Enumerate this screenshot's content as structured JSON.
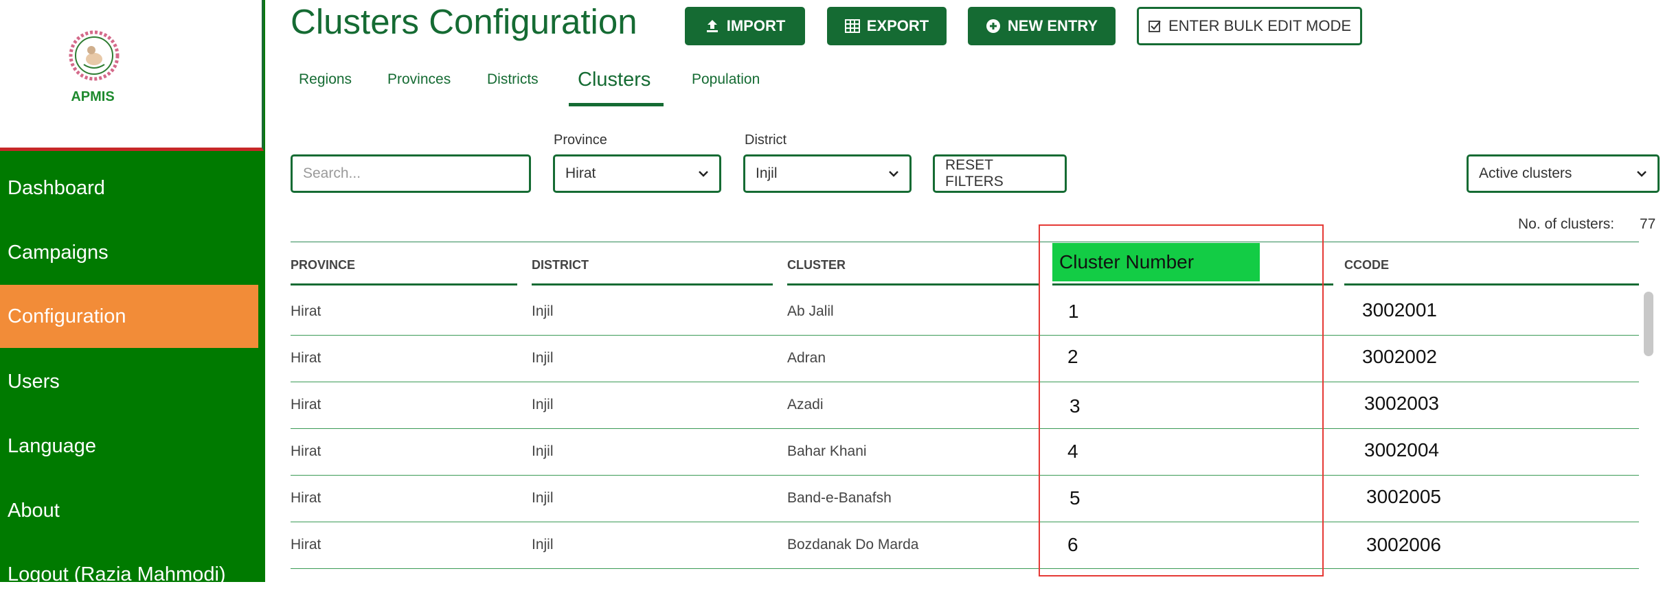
{
  "app": {
    "name": "APMIS"
  },
  "sidebar": {
    "items": [
      {
        "label": "Dashboard",
        "active": false
      },
      {
        "label": "Campaigns",
        "active": false
      },
      {
        "label": "Configuration",
        "active": true
      },
      {
        "label": "Users",
        "active": false
      },
      {
        "label": "Language",
        "active": false
      },
      {
        "label": "About",
        "active": false
      },
      {
        "label": "Logout (Razia Mahmodi)",
        "active": false
      }
    ]
  },
  "header": {
    "title": "Clusters Configuration",
    "buttons": {
      "import": "IMPORT",
      "export": "EXPORT",
      "new_entry": "NEW ENTRY",
      "bulk_edit": "ENTER BULK EDIT MODE"
    }
  },
  "tabs": [
    {
      "label": "Regions",
      "active": false
    },
    {
      "label": "Provinces",
      "active": false
    },
    {
      "label": "Districts",
      "active": false
    },
    {
      "label": "Clusters",
      "active": true
    },
    {
      "label": "Population",
      "active": false
    }
  ],
  "filters": {
    "search_placeholder": "Search...",
    "province": {
      "label": "Province",
      "value": "Hirat"
    },
    "district": {
      "label": "District",
      "value": "Injil"
    },
    "reset_label": "RESET FILTERS",
    "status": {
      "value": "Active clusters"
    }
  },
  "summary": {
    "label": "No. of clusters:",
    "value": "77"
  },
  "table": {
    "columns": {
      "province": "PROVINCE",
      "district": "DISTRICT",
      "cluster": "CLUSTER",
      "cluster_number": "Cluster Number",
      "ccode": "CCODE"
    },
    "rows": [
      {
        "province": "Hirat",
        "district": "Injil",
        "cluster": "Ab Jalil",
        "cluster_number": "1",
        "ccode": "3002001"
      },
      {
        "province": "Hirat",
        "district": "Injil",
        "cluster": "Adran",
        "cluster_number": "2",
        "ccode": "3002002"
      },
      {
        "province": "Hirat",
        "district": "Injil",
        "cluster": "Azadi",
        "cluster_number": "3",
        "ccode": "3002003"
      },
      {
        "province": "Hirat",
        "district": "Injil",
        "cluster": "Bahar Khani",
        "cluster_number": "4",
        "ccode": "3002004"
      },
      {
        "province": "Hirat",
        "district": "Injil",
        "cluster": "Band-e-Banafsh",
        "cluster_number": "5",
        "ccode": "3002005"
      },
      {
        "province": "Hirat",
        "district": "Injil",
        "cluster": "Bozdanak Do Marda",
        "cluster_number": "6",
        "ccode": "3002006"
      }
    ]
  },
  "colors": {
    "primary": "#156b33",
    "sidebar": "#007a00",
    "active_nav": "#f28c38",
    "highlight_header": "#13cc45",
    "annotation": "#e53935"
  }
}
